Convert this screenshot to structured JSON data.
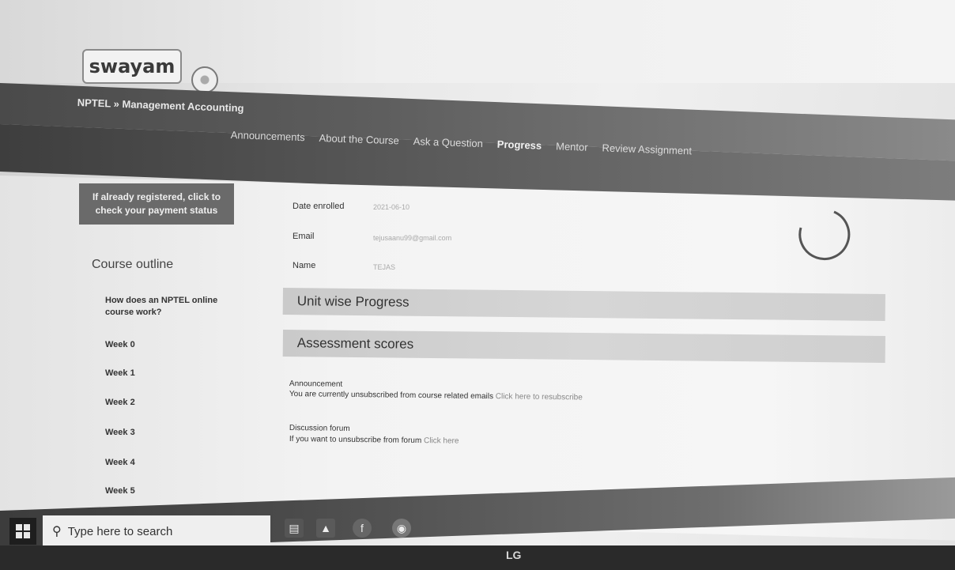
{
  "header": {
    "logo_text": "swayam",
    "course_title": "NPTEL » Management Accounting"
  },
  "nav": {
    "items": [
      {
        "label": "Announcements",
        "active": false
      },
      {
        "label": "About the Course",
        "active": false
      },
      {
        "label": "Ask a Question",
        "active": false
      },
      {
        "label": "Progress",
        "active": true
      },
      {
        "label": "Mentor",
        "active": false
      },
      {
        "label": "Review Assignment",
        "active": false
      }
    ]
  },
  "sidebar": {
    "payment_button": "If already registered, click to check your payment status",
    "outline_heading": "Course outline",
    "items": [
      "How does an NPTEL online course work?",
      "Week 0",
      "Week 1",
      "Week 2",
      "Week 3",
      "Week 4",
      "Week 5"
    ]
  },
  "profile": {
    "date_label": "Date enrolled",
    "date_value": "2021-06-10",
    "email_label": "Email",
    "email_value": "tejusaanu99@gmail.com",
    "name_label": "Name",
    "name_value": "TEJAS"
  },
  "sections": {
    "unit_progress": "Unit wise Progress",
    "assessment_scores": "Assessment scores"
  },
  "notices": {
    "announcement_heading": "Announcement",
    "announcement_text": "You are currently unsubscribed from course related emails",
    "announcement_link": "Click here to resubscribe",
    "forum_heading": "Discussion forum",
    "forum_text": "If you want to unsubscribe from forum",
    "forum_link": "Click here"
  },
  "taskbar": {
    "search_placeholder": "Type here to search",
    "monitor_brand": "LG"
  },
  "colors": {
    "nav_bg": "#4f4f4f",
    "section_bar_bg": "#cfcfcf",
    "payment_button_bg": "#6a6a6a",
    "taskbar_bg": "#3c3c3c"
  }
}
